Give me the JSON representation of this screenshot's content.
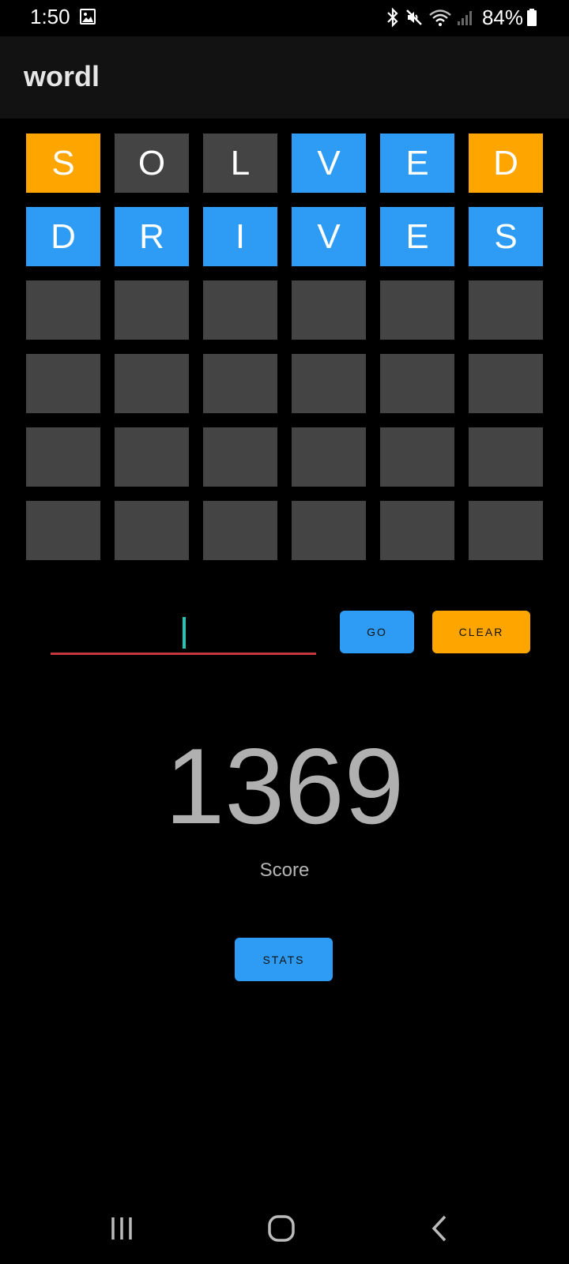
{
  "status_bar": {
    "time": "1:50",
    "battery": "84%",
    "icons": [
      "image-icon",
      "bluetooth-icon",
      "mute-icon",
      "wifi-icon",
      "signal-icon",
      "battery-icon"
    ]
  },
  "app": {
    "title": "wordl"
  },
  "grid": {
    "rows": [
      [
        {
          "letter": "S",
          "state": "orange"
        },
        {
          "letter": "O",
          "state": "gray"
        },
        {
          "letter": "L",
          "state": "gray"
        },
        {
          "letter": "V",
          "state": "blue"
        },
        {
          "letter": "E",
          "state": "blue"
        },
        {
          "letter": "D",
          "state": "orange"
        }
      ],
      [
        {
          "letter": "D",
          "state": "blue"
        },
        {
          "letter": "R",
          "state": "blue"
        },
        {
          "letter": "I",
          "state": "blue"
        },
        {
          "letter": "V",
          "state": "blue"
        },
        {
          "letter": "E",
          "state": "blue"
        },
        {
          "letter": "S",
          "state": "blue"
        }
      ],
      [
        {
          "letter": "",
          "state": "gray"
        },
        {
          "letter": "",
          "state": "gray"
        },
        {
          "letter": "",
          "state": "gray"
        },
        {
          "letter": "",
          "state": "gray"
        },
        {
          "letter": "",
          "state": "gray"
        },
        {
          "letter": "",
          "state": "gray"
        }
      ],
      [
        {
          "letter": "",
          "state": "gray"
        },
        {
          "letter": "",
          "state": "gray"
        },
        {
          "letter": "",
          "state": "gray"
        },
        {
          "letter": "",
          "state": "gray"
        },
        {
          "letter": "",
          "state": "gray"
        },
        {
          "letter": "",
          "state": "gray"
        }
      ],
      [
        {
          "letter": "",
          "state": "gray"
        },
        {
          "letter": "",
          "state": "gray"
        },
        {
          "letter": "",
          "state": "gray"
        },
        {
          "letter": "",
          "state": "gray"
        },
        {
          "letter": "",
          "state": "gray"
        },
        {
          "letter": "",
          "state": "gray"
        }
      ],
      [
        {
          "letter": "",
          "state": "gray"
        },
        {
          "letter": "",
          "state": "gray"
        },
        {
          "letter": "",
          "state": "gray"
        },
        {
          "letter": "",
          "state": "gray"
        },
        {
          "letter": "",
          "state": "gray"
        },
        {
          "letter": "",
          "state": "gray"
        }
      ]
    ]
  },
  "input": {
    "value": "",
    "placeholder": ""
  },
  "buttons": {
    "go": "GO",
    "clear": "CLEAR",
    "stats": "STATS"
  },
  "score": {
    "value": "1369",
    "label": "Score"
  },
  "colors": {
    "orange": "#ffa500",
    "blue": "#2e9cf5",
    "gray": "#444444",
    "underline": "#c5383f",
    "caret": "#26c6b7"
  },
  "nav_bar": {
    "icons": [
      "recents-icon",
      "home-icon",
      "back-icon"
    ]
  }
}
